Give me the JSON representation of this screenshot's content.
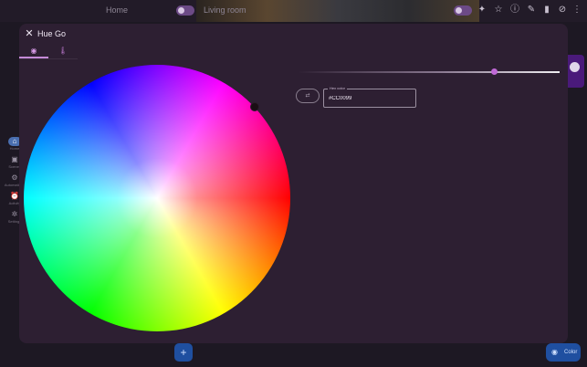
{
  "topbar": {
    "left_label": "Home",
    "right_label": "Living room",
    "actions": [
      "star-icon",
      "info-icon",
      "edit-icon",
      "delete-icon",
      "eye-off-icon",
      "more-vert-icon"
    ],
    "scene_icon": "scene-icon"
  },
  "sidebar": {
    "items": [
      {
        "label": "Home",
        "icon": "home-icon"
      },
      {
        "label": "Scenes",
        "icon": "scenes-icon"
      },
      {
        "label": "Automations",
        "icon": "automations-icon"
      },
      {
        "label": "Activity",
        "icon": "alarm-icon"
      },
      {
        "label": "Settings",
        "icon": "gear-icon"
      }
    ]
  },
  "dialog": {
    "title": "Hue Go",
    "tabs": [
      {
        "icon": "palette-icon",
        "active": true
      },
      {
        "icon": "thermometer-icon",
        "active": false
      }
    ],
    "wheel_selection": {
      "hex": "#CC0099",
      "hue_deg": 317
    },
    "brightness": 0.75,
    "swap_label": "⇄",
    "hex_field": {
      "label": "Hex color",
      "value": "#CC0099"
    }
  },
  "fab": {
    "add_label": "+",
    "color_label": "Color"
  },
  "colors": {
    "dialog_bg": "#2d1f32",
    "accent": "#c069d6",
    "fab": "#1f4fa0"
  }
}
